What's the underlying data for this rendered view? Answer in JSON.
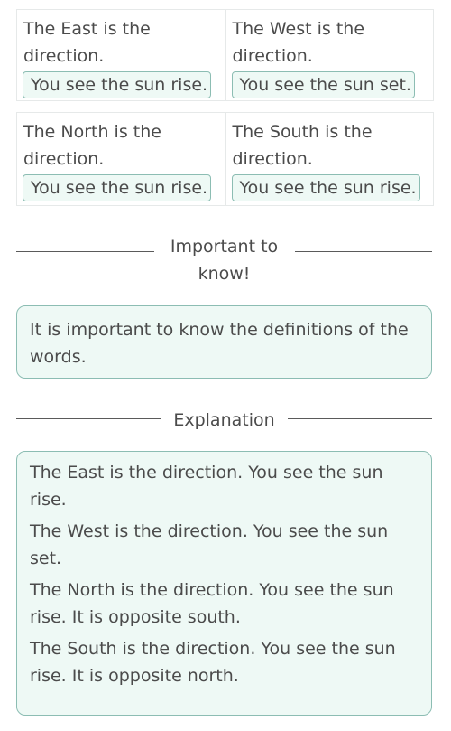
{
  "matching": [
    {
      "left": {
        "text": "The East is the direction.",
        "answer": "You see the sun rise."
      },
      "right": {
        "text": "The West is the direction.",
        "answer": "You see the sun set."
      }
    },
    {
      "left": {
        "text": "The North is the direction.",
        "answer": "You see the sun rise."
      },
      "right": {
        "text": "The South is the direction.",
        "answer": "You see the sun rise."
      }
    }
  ],
  "important": {
    "heading": "Important to know!",
    "text": "It is important to know the definitions of the words."
  },
  "explanation": {
    "heading": "Explanation",
    "paragraphs": [
      "The East is the direction. You see the sun rise.",
      "The West is the direction. You see the sun set.",
      "The North is the direction. You see the sun rise. It is opposite south.",
      "The South is the direction. You see the sun rise. It is opposite north."
    ]
  },
  "colors": {
    "chip_bg": "#eef9f5",
    "chip_border": "#8cbdb3",
    "text": "#4b4b4b"
  }
}
